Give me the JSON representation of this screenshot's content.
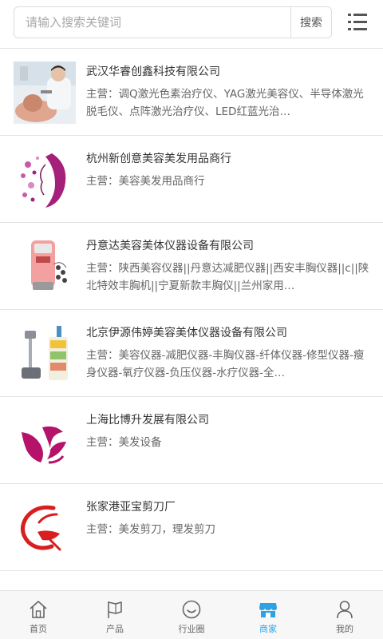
{
  "search": {
    "placeholder": "请输入搜索关键词",
    "value": "",
    "button_label": "搜索"
  },
  "companies": [
    {
      "name": "武汉华睿创鑫科技有限公司",
      "desc": "主营：调Q激光色素治疗仪、YAG激光美容仪、半导体激光脱毛仪、点阵激光治疗仪、LED红蓝光治…"
    },
    {
      "name": "杭州新创意美容美发用品商行",
      "desc": "主营：美容美发用品商行"
    },
    {
      "name": "丹意达美容美体仪器设备有限公司",
      "desc": "主营：陕西美容仪器||丹意达减肥仪器||西安丰胸仪器||c||陕北特效丰胸机||宁夏新款丰胸仪||兰州家用…"
    },
    {
      "name": "北京伊源伟婷美容美体仪器设备有限公司",
      "desc": "主营：美容仪器-减肥仪器-丰胸仪器-纤体仪器-修型仪器-瘦身仪器-氧疗仪器-负压仪器-水疗仪器-全…"
    },
    {
      "name": "上海比博升发展有限公司",
      "desc": "主营：美发设备"
    },
    {
      "name": "张家港亚宝剪刀厂",
      "desc": "主营：美发剪刀，理发剪刀"
    }
  ],
  "nav": {
    "items": [
      {
        "label": "首页",
        "icon": "home-icon"
      },
      {
        "label": "产品",
        "icon": "flag-icon"
      },
      {
        "label": "行业圈",
        "icon": "smile-icon"
      },
      {
        "label": "商家",
        "icon": "store-icon",
        "active": true
      },
      {
        "label": "我的",
        "icon": "person-icon"
      }
    ]
  },
  "colors": {
    "active": "#2da3e6",
    "logo_magenta": "#b5126a",
    "logo_red": "#d81e1e"
  }
}
